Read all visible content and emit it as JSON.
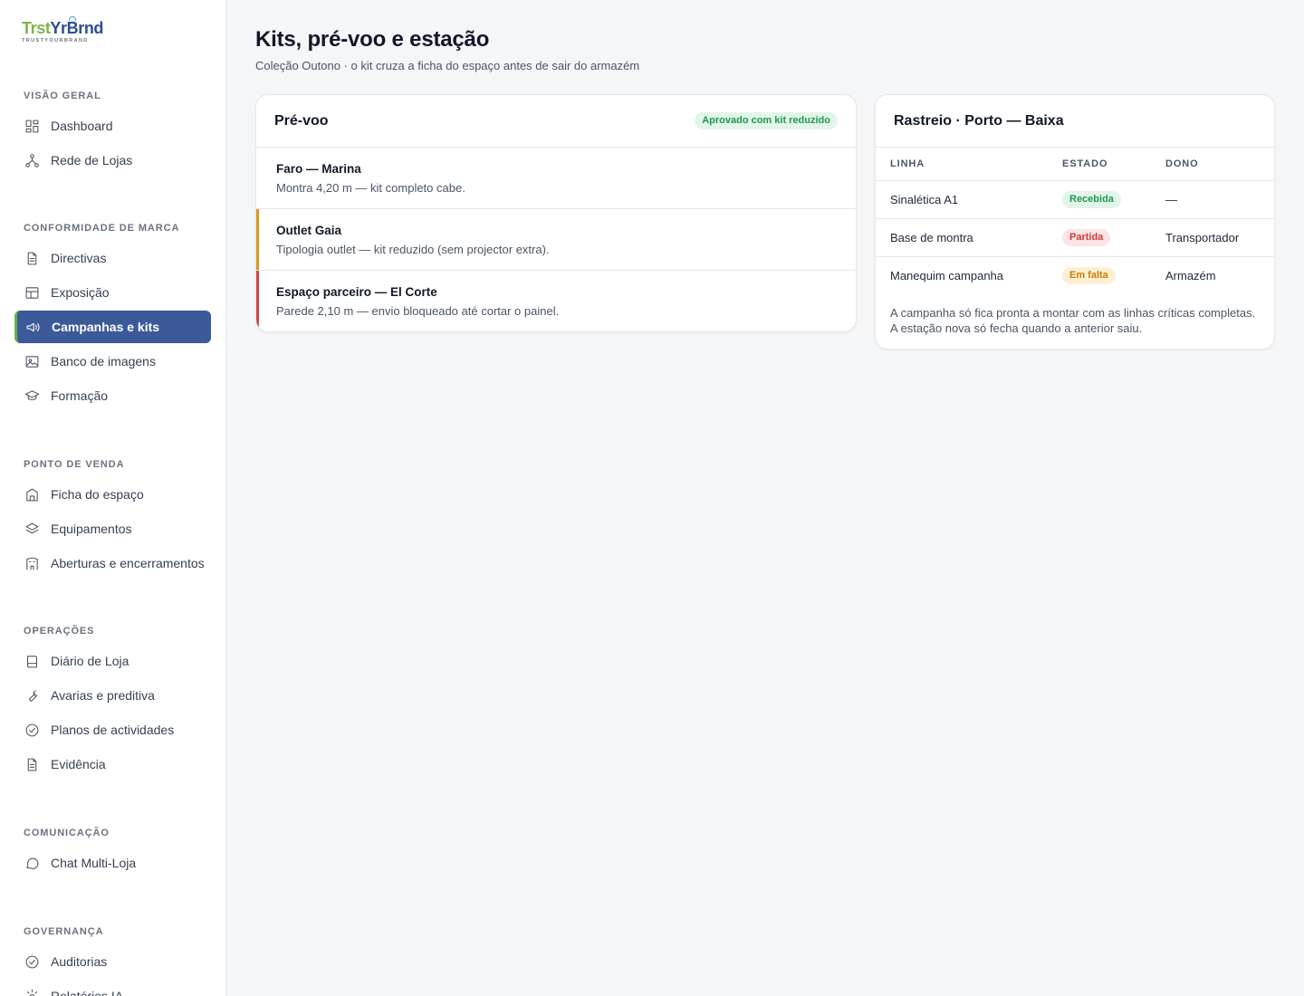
{
  "logo": {
    "word_part1": "Trst",
    "word_part2": "YrBrnd",
    "tagline": "TRUSTYOURBRAND"
  },
  "sidebar": {
    "sections": [
      {
        "label": "Visão geral"
      },
      {
        "label": "Conformidade de marca"
      },
      {
        "label": "Ponto de venda"
      },
      {
        "label": "Operações"
      },
      {
        "label": "Comunicação"
      },
      {
        "label": "Governança"
      }
    ],
    "items": [
      {
        "label": "Dashboard",
        "icon": "grid-icon"
      },
      {
        "label": "Rede de Lojas",
        "icon": "network-icon"
      },
      {
        "label": "Directivas",
        "icon": "document-icon"
      },
      {
        "label": "Exposição",
        "icon": "layout-icon"
      },
      {
        "label": "Campanhas e kits",
        "icon": "megaphone-icon",
        "active": true
      },
      {
        "label": "Banco de imagens",
        "icon": "image-icon"
      },
      {
        "label": "Formação",
        "icon": "graduation-cap-icon"
      },
      {
        "label": "Ficha do espaço",
        "icon": "storefront-icon"
      },
      {
        "label": "Equipamentos",
        "icon": "layers-icon"
      },
      {
        "label": "Aberturas e encerramentos",
        "icon": "building-icon"
      },
      {
        "label": "Diário de Loja",
        "icon": "book-icon"
      },
      {
        "label": "Avarias e preditiva",
        "icon": "wrench-icon"
      },
      {
        "label": "Planos de actividades",
        "icon": "check-circle-icon"
      },
      {
        "label": "Evidência",
        "icon": "document-icon"
      },
      {
        "label": "Chat Multi-Loja",
        "icon": "chat-bubble-icon"
      },
      {
        "label": "Auditorias",
        "icon": "check-circle-icon"
      },
      {
        "label": "Relatórios IA",
        "icon": "sparkle-icon"
      }
    ]
  },
  "main": {
    "title": "Kits, pré-voo e estação",
    "subtitle": "Coleção Outono · o kit cruza a ficha do espaço antes de sair do armazém"
  },
  "preflight": {
    "title": "Pré-voo",
    "status_badge": "Aprovado com kit reduzido",
    "rows": [
      {
        "name": "Faro — Marina",
        "desc": "Montra 4,20 m — kit completo cabe.",
        "accent": ""
      },
      {
        "name": "Outlet Gaia",
        "desc": "Tipologia outlet — kit reduzido (sem projector extra).",
        "accent": "#d99a1e"
      },
      {
        "name": "Espaço parceiro — El Corte",
        "desc": "Parede 2,10 m — envio bloqueado até cortar o painel.",
        "accent": "#d64545"
      }
    ]
  },
  "tracking": {
    "title": "Rastreio · Porto — Baixa",
    "columns": [
      "Linha",
      "Estado",
      "Dono"
    ],
    "rows": [
      {
        "line": "Sinalética A1",
        "status": "Recebida",
        "status_color": "green",
        "owner": "—"
      },
      {
        "line": "Base de montra",
        "status": "Partida",
        "status_color": "red",
        "owner": "Transportador"
      },
      {
        "line": "Manequim campanha",
        "status": "Em falta",
        "status_color": "amber",
        "owner": "Armazém"
      }
    ],
    "note": "A campanha só fica pronta a montar com as linhas críticas completas. A estação nova só fecha quando a anterior saiu."
  }
}
